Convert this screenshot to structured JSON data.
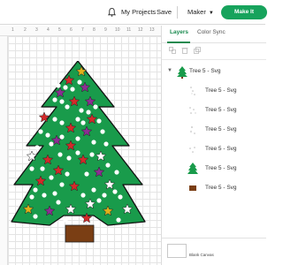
{
  "header": {
    "my_projects": "My Projects",
    "save": "Save",
    "machine": "Maker",
    "make_it": "Make It"
  },
  "ruler": {
    "ticks": [
      "1",
      "2",
      "3",
      "4",
      "5",
      "6",
      "7",
      "8",
      "9",
      "10",
      "11",
      "12",
      "13"
    ]
  },
  "canvas": {
    "tree_green": "#199b4b",
    "trunk_color": "#7a3e14",
    "star_colors": [
      "#e0b21b",
      "#8c2e93",
      "#d32a2a",
      "#ffffff"
    ]
  },
  "panel": {
    "tabs": [
      "Layers",
      "Color Sync"
    ],
    "group_label": "Tree 5 - Svg",
    "layers": [
      {
        "label": "Tree 5 - Svg",
        "icon": "white-dots-icon"
      },
      {
        "label": "Tree 5 - Svg",
        "icon": "white-dots-icon"
      },
      {
        "label": "Tree 5 - Svg",
        "icon": "white-stars-icon"
      },
      {
        "label": "Tree 5 - Svg",
        "icon": "white-dots-icon"
      },
      {
        "label": "Tree 5 - Svg",
        "icon": "green-tree-icon"
      },
      {
        "label": "Tree 5 - Svg",
        "icon": "brown-trunk-icon"
      }
    ],
    "blank_canvas": "Blank Canvas",
    "accent": "#1a8a4f"
  }
}
